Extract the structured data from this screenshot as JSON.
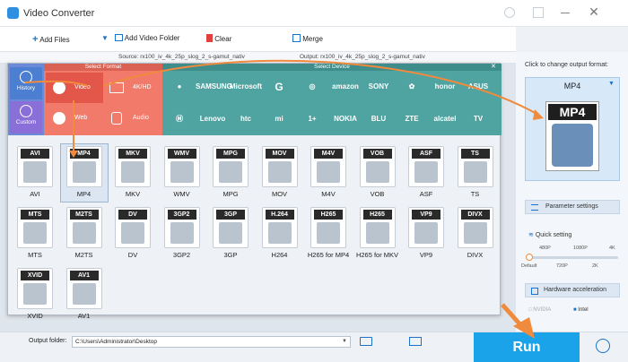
{
  "app": {
    "title": "Video Converter"
  },
  "toolbar": {
    "add_files": "Add Files",
    "add_folder": "Add Video Folder",
    "clear": "Clear",
    "merge": "Merge"
  },
  "file": {
    "source": "Source: rx100_iv_4k_25p_slog_2_s-gamut_nativ",
    "output": "Output: rx100_iv_4k_25p_slog_2_s-gamut_nativ"
  },
  "popup": {
    "select_format": "Select Format",
    "select_device": "Select Device",
    "side": [
      "History",
      "Custom"
    ],
    "categories": [
      "Video",
      "4K/HD",
      "Web",
      "Audio"
    ],
    "brands_row1": [
      "",
      "SAMSUNG",
      "Microsoft",
      "G",
      "",
      "amazon",
      "SONY",
      "",
      "honor",
      "ASUS"
    ],
    "brands_row2": [
      "",
      "Lenovo",
      "htc",
      "mi",
      "",
      "NOKIA",
      "BLU",
      "ZTE",
      "alcatel",
      "TV"
    ],
    "formats": [
      {
        "tag": "AVI",
        "label": "AVI"
      },
      {
        "tag": "MP4",
        "label": "MP4"
      },
      {
        "tag": "MKV",
        "label": "MKV"
      },
      {
        "tag": "WMV",
        "label": "WMV"
      },
      {
        "tag": "MPG",
        "label": "MPG"
      },
      {
        "tag": "MOV",
        "label": "MOV"
      },
      {
        "tag": "M4V",
        "label": "M4V"
      },
      {
        "tag": "VOB",
        "label": "VOB"
      },
      {
        "tag": "ASF",
        "label": "ASF"
      },
      {
        "tag": "TS",
        "label": "TS"
      },
      {
        "tag": "MTS",
        "label": "MTS"
      },
      {
        "tag": "M2TS",
        "label": "M2TS"
      },
      {
        "tag": "DV",
        "label": "DV"
      },
      {
        "tag": "3GP2",
        "label": "3GP2"
      },
      {
        "tag": "3GP",
        "label": "3GP"
      },
      {
        "tag": "H.264",
        "label": "H264"
      },
      {
        "tag": "H265",
        "label": "H265 for MP4"
      },
      {
        "tag": "H265",
        "label": "H265 for MKV"
      },
      {
        "tag": "VP9",
        "label": "VP9"
      },
      {
        "tag": "DIVX",
        "label": "DIVX"
      },
      {
        "tag": "XVID",
        "label": "XVID"
      },
      {
        "tag": "AV1",
        "label": "AV1"
      }
    ]
  },
  "right": {
    "hint": "Click to change output format:",
    "format": "MP4",
    "param": "Parameter settings",
    "quick": "Quick setting",
    "ticks_top": [
      "480P",
      "1080P",
      "4K"
    ],
    "ticks_bottom": [
      "Default",
      "720P",
      "2K"
    ],
    "hw": "Hardware acceleration",
    "nvidia": "NVIDIA",
    "intel": "Intel"
  },
  "bottom": {
    "output_folder_label": "Output folder:",
    "output_path": "C:\\Users\\Administrator\\Desktop",
    "run": "Run"
  },
  "colors": {
    "accent": "#1aa3e8",
    "orange": "#f08a3c",
    "teal": "#4fa3a1"
  }
}
